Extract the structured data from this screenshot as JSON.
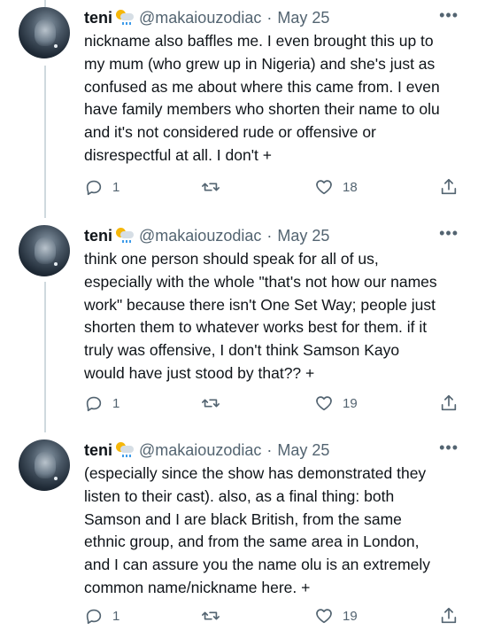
{
  "tweets": [
    {
      "name": "teni",
      "handle": "@makaiouzodiac",
      "separator": "·",
      "date": "May 25",
      "more": "•••",
      "lines": [
        "nickname also baffles me. I even brought this up to",
        "my mum (who grew up in Nigeria) and she's just as",
        "confused as me about where this came from. I even",
        "have family members who shorten their name to olu",
        "and it's not considered rude or offensive or",
        "disrespectful at all. I don't +"
      ],
      "replies": "1",
      "retweets": "",
      "likes": "18"
    },
    {
      "name": "teni",
      "handle": "@makaiouzodiac",
      "separator": "·",
      "date": "May 25",
      "more": "•••",
      "lines": [
        "think one person should speak for all of us,",
        "especially with the whole \"that's not how our names",
        "work\" because there isn't One Set Way; people just",
        "shorten them to whatever works best for them. if it",
        "truly was offensive, I don't think Samson Kayo",
        "would have just stood by that?? +"
      ],
      "replies": "1",
      "retweets": "",
      "likes": "19"
    },
    {
      "name": "teni",
      "handle": "@makaiouzodiac",
      "separator": "·",
      "date": "May 25",
      "more": "•••",
      "lines": [
        "(especially since the show has demonstrated they",
        "listen to their cast). also, as a final thing: both",
        "Samson and I are black British, from the same",
        "ethnic group, and from the same area in London,",
        "and I can assure you the name olu is an extremely",
        "common name/nickname here. +"
      ],
      "replies": "1",
      "retweets": "",
      "likes": "19"
    }
  ],
  "icons": {
    "emoji": "sun-behind-rain-cloud-emoji",
    "reply": "reply-icon",
    "retweet": "retweet-icon",
    "like": "heart-icon",
    "share": "share-icon"
  },
  "colors": {
    "text": "#0f1419",
    "secondary": "#536471",
    "thread_line": "#cfd9de",
    "background": "#ffffff"
  }
}
